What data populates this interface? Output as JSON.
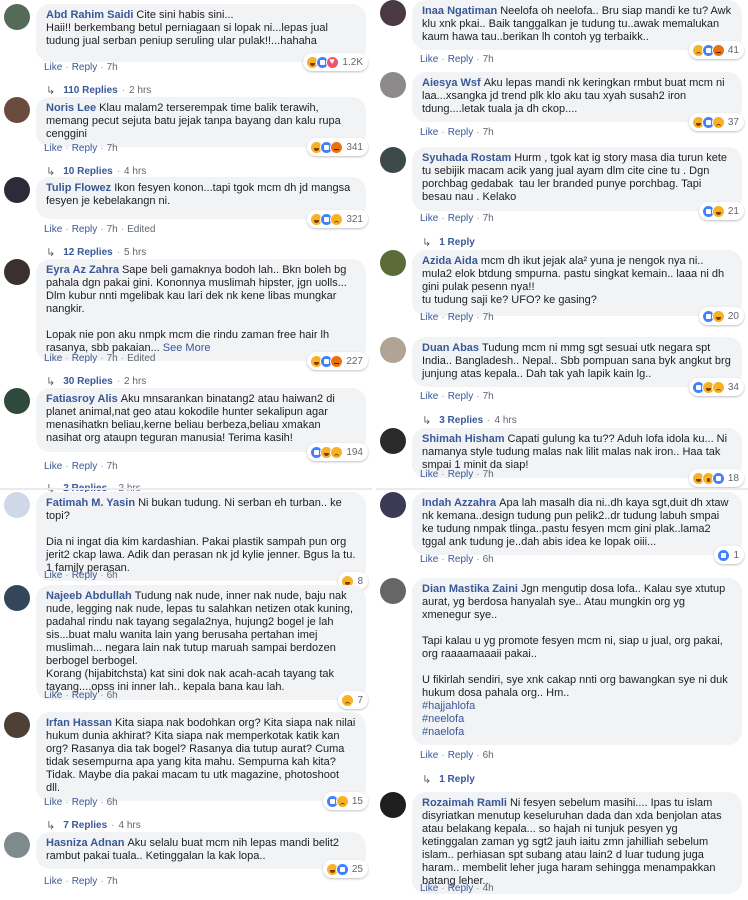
{
  "colors": {
    "link": "#385898",
    "bubble": "#f2f3f5",
    "meta": "#606770",
    "like": "#4080ff",
    "haha": "#f7b125",
    "love": "#f25268"
  },
  "actions": {
    "like": "Like",
    "reply": "Reply",
    "separator": "·",
    "edited": "Edited",
    "replies_arrow": "↳"
  },
  "left": [
    {
      "name": "Abd Rahim Saidi",
      "text": "Cite sini habis sini...\nHaii!! berkembang betul perniagaan si lopak ni...lepas jual tudung jual serban peniup seruling ular pulak!!...hahaha",
      "reactions": [
        "haha",
        "like",
        "love"
      ],
      "count": "1.2K",
      "time": "7h",
      "edited": "",
      "replies": "110 Replies",
      "replies_time": "2 hrs"
    },
    {
      "name": "Noris Lee",
      "text": "Klau malam2 terserempak time balik terawih, memang pecut sejuta batu jejak tanpa bayang dan kalu rupa cenggini",
      "reactions": [
        "haha",
        "like",
        "angry"
      ],
      "count": "341",
      "time": "7h",
      "edited": "",
      "replies": "10 Replies",
      "replies_time": "4 hrs"
    },
    {
      "name": "Tulip Flowez",
      "text": "Ikon fesyen konon...tapi tgok mcm dh jd mangsa fesyen je kebelakangn ni.",
      "reactions": [
        "haha",
        "like",
        "sad"
      ],
      "count": "321",
      "time": "7h",
      "edited": "Edited",
      "replies": "12 Replies",
      "replies_time": "5 hrs"
    },
    {
      "name": "Eyra Az Zahra",
      "text": "Sape beli gamaknya bodoh lah.. Bkn boleh bg pahala dgn pakai gini. Kononnya muslimah hipster, jgn uolls... Dlm kubur nnti mgelibak kau lari dek nk kene libas mungkar nangkir.\n\nLopak nie pon aku nmpk mcm die rindu zaman free hair lh rasanya, sbb pakaian... ",
      "see_more": "See More",
      "reactions": [
        "haha",
        "like",
        "angry"
      ],
      "count": "227",
      "time": "7h",
      "edited": "Edited",
      "replies": "30 Replies",
      "replies_time": "2 hrs"
    },
    {
      "name": "Fatiasroy Alis",
      "text": "Aku mnsarankan binatang2 atau haiwan2 di planet animal,nat geo atau kokodile hunter sekalipun agar menasihatkn beliau,kerne beliau berbeza,beliau xmakan nasihat org ataupn teguran manusia! Terima kasih!",
      "reactions": [
        "like",
        "haha",
        "sad"
      ],
      "count": "194",
      "time": "7h",
      "edited": "",
      "replies": "2 Replies",
      "replies_time": "2 hrs"
    },
    {
      "name": "Fatimah M. Yasin",
      "text": "Ni bukan tudung. Ni serban eh turban.. ke topi?\n\nDia ni ingat dia kim kardashian. Pakai plastik sampah pun org jerit2 ckap lawa. Adik dan perasan nk jd kylie jenner. Bgus la tu. 1 family perasan.",
      "reactions": [
        "haha"
      ],
      "count": "8",
      "time": "6h",
      "edited": ""
    },
    {
      "name": "Najeeb Abdullah",
      "text": "Tudung nak nude, inner nak nude, baju nak nude, legging nak nude, lepas tu salahkan netizen otak kuning, padahal rindu nak tayang segala2nya, hujung2 bogel je lah sis...buat malu wanita lain yang berusaha pertahan imej muslimah... negara lain nak tutup maruah sampai berdozen berbogel berbogel.\nKorang (hijabitchsta) kat sini dok nak acah-acah tayang tak tayang....opss ini inner lah.. kepala bana kau lah.",
      "reactions": [
        "sad"
      ],
      "count": "7",
      "time": "6h",
      "edited": ""
    },
    {
      "name": "Irfan Hassan",
      "text": "Kita siapa nak bodohkan org? Kita siapa nak nilai hukum dunia akhirat? Kita siapa nak memperkotak katik kan org? Rasanya dia tak bogel? Rasanya dia tutup aurat? Cuma tidak sesempurna apa yang kita mahu. Sempurna kah kita? Tidak. Maybe dia pakai macam tu utk magazine, photoshoot dll.",
      "reactions": [
        "like",
        "sad"
      ],
      "count": "15",
      "time": "6h",
      "edited": "",
      "replies": "7 Replies",
      "replies_time": "4 hrs"
    },
    {
      "name": "Hasniza Adnan",
      "text": "Aku selalu buat mcm nih lepas mandi belit2 rambut pakai tuala.. Ketinggalan la kak lopa..",
      "reactions": [
        "haha",
        "like"
      ],
      "count": "25",
      "time": "7h",
      "edited": ""
    }
  ],
  "right": [
    {
      "name": "Inaa Ngatiman",
      "text": "Neelofa oh neelofa.. Bru siap mandi ke tu? Awk klu xnk pkai.. Baik tanggalkan je tudung tu..awak memalukan kaum hawa tau..berikan lh contoh yg terbaikk..",
      "reactions": [
        "sad",
        "like",
        "angry"
      ],
      "count": "41",
      "time": "7h",
      "edited": ""
    },
    {
      "name": "Aiesya Wsf",
      "text": "Aku lepas mandi nk keringkan rmbut buat mcm ni laa...xsangka jd trend plk klo aku tau xyah susah2 iron tdung....letak tuala ja dh ckop....",
      "reactions": [
        "haha",
        "like",
        "sad"
      ],
      "count": "37",
      "time": "7h",
      "edited": ""
    },
    {
      "name": "Syuhada Rostam",
      "text": "Hurm , tgok kat ig story masa dia turun kete tu sebijik macam acik yang jual ayam dlm cite cine tu . Dgn porchbag gedabak  tau ler branded punye porchbag. Tapi besau nau . Kelako",
      "reactions": [
        "like",
        "haha"
      ],
      "count": "21",
      "time": "7h",
      "edited": "",
      "replies": "1 Reply",
      "replies_time": ""
    },
    {
      "name": "Azida Aida",
      "text": "mcm dh ikut jejak ala² yuna je nengok nya ni.. mula2 elok btdung smpurna. pastu singkat kemain.. laaa ni dh gini pulak pesenn nya!! \ntu tudung saji ke? UFO? ke gasing? ",
      "reactions": [
        "like",
        "haha"
      ],
      "count": "20",
      "time": "7h",
      "edited": ""
    },
    {
      "name": "Duan Abas",
      "text": "Tudung mcm ni mmg sgt sesuai utk negara spt India.. Bangladesh.. Nepal.. Sbb pompuan sana byk angkut brg junjung atas kepala.. Dah tak yah lapik kain lg..",
      "reactions": [
        "like",
        "haha",
        "sad"
      ],
      "count": "34",
      "time": "7h",
      "edited": "",
      "replies": "3 Replies",
      "replies_time": "4 hrs"
    },
    {
      "name": "Shimah Hisham",
      "text": "Capati gulung ka tu?? Aduh lofa idola ku... Ni namanya style tudung malas nak lilit malas nak iron.. Haa tak smpai 1 minit da siap!",
      "reactions": [
        "haha",
        "wow",
        "like"
      ],
      "count": "18",
      "time": "7h",
      "edited": ""
    },
    {
      "name": "Indah Azzahra",
      "text": "Apa lah masalh dia ni..dh kaya sgt,duit dh xtaw nk kemana..design tudung pun pelik2..dr tudung labuh smpai ke tudung nmpak tlinga..pastu fesyen mcm gini plak..lama2 tggal ank tudung je..dah abis idea ke lopak oiii...",
      "reactions": [
        "like"
      ],
      "count": "1",
      "time": "6h",
      "edited": ""
    },
    {
      "name": "Dian Mastika Zaini",
      "text": "Jgn mengutip dosa lofa.. Kalau sye xtutup aurat, yg berdosa hanyalah sye.. Atau mungkin org yg xmenegur sye..\n\nTapi kalau u yg promote fesyen mcm ni, siap u jual, org pakai, org raaaamaaaii pakai..\n\nU fikirlah sendiri, sye xnk cakap nnti org bawangkan sye ni duk hukum dosa pahala org.. Hm..\n",
      "tags": [
        "#hajjahlofa",
        "#neelofa",
        "#naelofa"
      ],
      "time": "6h",
      "edited": "",
      "replies": "1 Reply",
      "replies_time": ""
    },
    {
      "name": "Rozaimah Ramli",
      "text": "Ni fesyen sebelum masihi.... Ipas tu islam disyriatkan menutup keseluruhan dada dan xda benjolan atas atau belakang kepala... so hajah ni tunjuk pesyen yg ketinggalan zaman yg sgt2 jauh iaitu zmn jahilliah sebelum islam.. perhiasan spt subang atau lain2 d luar tudung juga haram.. membelit leher juga haram sehingga menampakkan batang leher..",
      "time": "4h",
      "edited": ""
    }
  ]
}
